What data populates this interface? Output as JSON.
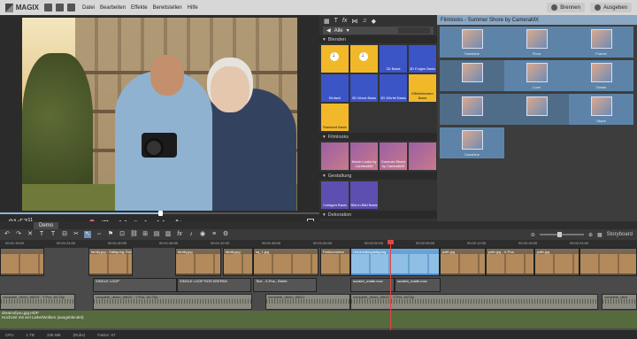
{
  "app": {
    "brand": "MAGIX",
    "menu": [
      "Datei",
      "Bearbeiten",
      "Effekte",
      "Bereitstellen",
      "Hilfe"
    ],
    "burn_label": "Brennen",
    "export_label": "Ausgeben"
  },
  "preview": {
    "timecode": "01:57",
    "timecode_frames": "11",
    "progress": 0.5
  },
  "pool": {
    "tab_icons": [
      "grid-icon",
      "text-icon",
      "fx-icon",
      "transition-icon",
      "music-icon",
      "tag-icon"
    ],
    "filter_label": "Alle",
    "sections": [
      {
        "title": "Blenden",
        "tiles": [
          {
            "label": "",
            "style": "download"
          },
          {
            "label": "",
            "style": "download"
          },
          {
            "label": "3D Basis",
            "style": "blue"
          },
          {
            "label": "3D Folgen Basis",
            "style": "blue"
          },
          {
            "label": "Einfach",
            "style": "blue"
          },
          {
            "label": "3D Wurst Basis",
            "style": "blue"
          },
          {
            "label": "3D Würfel Basis",
            "style": "blue"
          },
          {
            "label": "Effektblenden Basis",
            "style": "plain"
          },
          {
            "label": "Standard Basis",
            "style": "plain"
          }
        ]
      },
      {
        "title": "Filmlooks",
        "tiles": [
          {
            "label": "",
            "style": "film"
          },
          {
            "label": "Movie Looks by CameraMX",
            "style": "film"
          },
          {
            "label": "Summer Shore by CameraMX",
            "style": "film"
          },
          {
            "label": "",
            "style": "film"
          }
        ]
      },
      {
        "title": "Gestaltung",
        "tiles": [
          {
            "label": "Collagen Basis",
            "style": "purple"
          },
          {
            "label": "Bild-in-Bild Basis",
            "style": "purple"
          }
        ]
      },
      {
        "title": "Dekoration",
        "tiles": []
      }
    ]
  },
  "looks": {
    "header": "Filmlooks - Summer Shore by CameraMX",
    "items": [
      "Sunshine",
      "Flora",
      "France",
      "",
      "Love",
      "Ocean",
      "",
      "",
      "Stone",
      "Sunshine"
    ]
  },
  "timeline": {
    "tab": "Demo",
    "right_label": "Storyboard",
    "ruler": [
      "00:01:18:00",
      "00:01:24:00",
      "00:01:30:00",
      "00:01:36:00",
      "00:01:42:00",
      "00:01:48:00",
      "00:01:54:00",
      "00:02:00:00",
      "00:02:06:00",
      "00:02:12:00",
      "00:02:18:00",
      "00:02:24:00"
    ],
    "track1": [
      {
        "label": "",
        "sel": false
      },
      {
        "label": "family.jpg - Sattigung, Kontrast",
        "sel": false
      },
      {
        "label": "family.jpg",
        "sel": false
      },
      {
        "label": "family.jpg",
        "sel": false
      },
      {
        "label": "sq_1.jpg",
        "sel": false
      },
      {
        "label": "Farbkorrektur",
        "sel": false
      },
      {
        "label": "Horizontbegradigung",
        "sel": true
      },
      {
        "label": "path.jpg",
        "sel": false
      },
      {
        "label": "path.jpg - X-Pos.",
        "sel": false
      },
      {
        "label": "path.jpg",
        "sel": false
      },
      {
        "label": "",
        "sel": false
      }
    ],
    "track2": [
      {
        "label": "SINGLE LOOP"
      },
      {
        "label": "SINGLE LOOP ROS KEEPAN"
      },
      {
        "label": "Text - X-Pos., Breite"
      },
      {
        "label": "scratch_matte.mov"
      },
      {
        "label": "scratch_matte.mov"
      }
    ],
    "track3": [
      {
        "label": "complete_demo_title19 - Y-Pos. AV-Clip"
      },
      {
        "label": "complete_demo_title20 - Y-Pos. AV-Clip"
      },
      {
        "label": "complete_demo_title21"
      },
      {
        "label": "complete_demo_title22 - Y-Pos. AVClip"
      },
      {
        "label": "complete_dem"
      }
    ],
    "green_label": "dreamofyou.jpg.HDP",
    "green_sub": "Hochzeit mit viel Liebe/Wolken (ausgeblendet)",
    "playhead": "00:01:57:11"
  },
  "status": [
    "CPU",
    "1 TB",
    "336 MB",
    "(Ruhe)",
    "Faktor: 67"
  ]
}
